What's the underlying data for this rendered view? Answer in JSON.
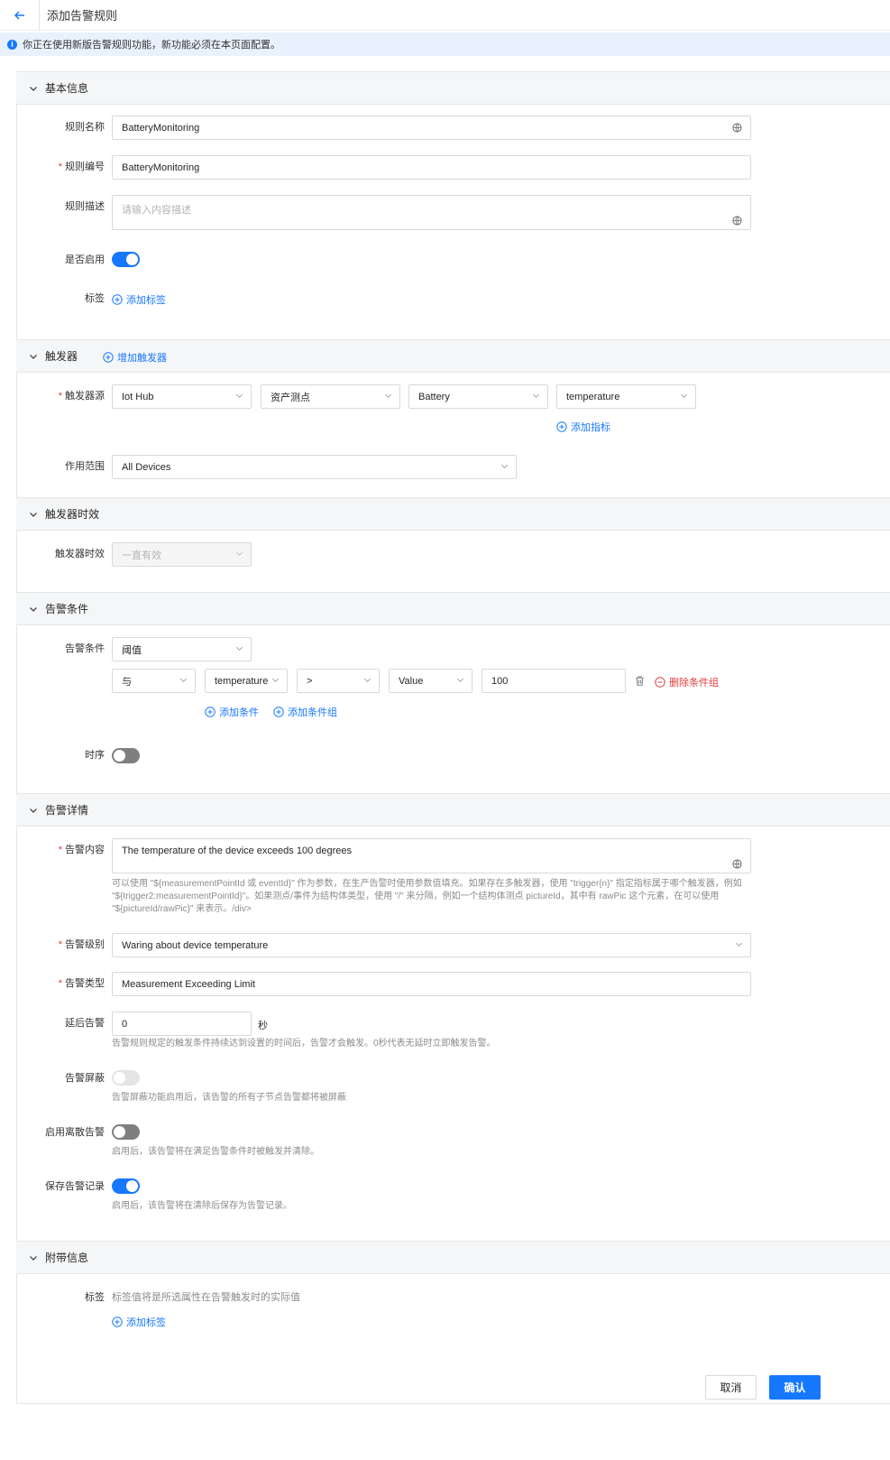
{
  "header": {
    "title": "添加告警规则"
  },
  "banner": {
    "text": "你正在使用新版告警规则功能，新功能必须在本页面配置。"
  },
  "sections": {
    "basic": "基本信息",
    "trigger": "触发器",
    "trigger_time": "触发器时效",
    "condition": "告警条件",
    "detail": "告警详情",
    "extra": "附带信息"
  },
  "basic": {
    "name_label": "规则名称",
    "name_value": "BatteryMonitoring",
    "code_label": "规则编号",
    "code_value": "BatteryMonitoring",
    "desc_label": "规则描述",
    "desc_placeholder": "请输入内容描述",
    "enabled_label": "是否启用",
    "tags_label": "标签",
    "add_tag": "添加标签"
  },
  "trigger": {
    "add_trigger": "增加触发器",
    "source_label": "触发器源",
    "source": "Iot Hub",
    "point_type": "资产测点",
    "asset": "Battery",
    "metric": "temperature",
    "add_metric": "添加指标",
    "scope_label": "作用范围",
    "scope": "All Devices"
  },
  "trigger_time": {
    "label": "触发器时效",
    "value": "一直有效"
  },
  "condition": {
    "label": "告警条件",
    "type": "阈值",
    "logic": "与",
    "field": "temperature",
    "operator": ">",
    "value_type": "Value",
    "threshold": "100",
    "delete_group": "删除条件组",
    "add_condition": "添加条件",
    "add_group": "添加条件组",
    "sequence_label": "时序"
  },
  "detail": {
    "content_label": "告警内容",
    "content_value": "The temperature of the device exceeds 100 degrees",
    "content_help_1": "可以使用 \"${measurementPointId 或 eventId}\" 作为参数，在生产告警时使用参数值填充。如果存在多触发器，使用 \"trigger{n}\" 指定指标属于哪个触发器，例如",
    "content_help_2": "\"${trigger2:measurementPointId}\"。如果测点/事件为结构体类型，使用 \"/\" 来分隔，例如一个结构体测点 pictureId，其中有 rawPic 这个元素，在可以使用",
    "content_help_3": "\"${pictureId/rawPic}\" 来表示。/div>",
    "level_label": "告警级别",
    "level_value": "Waring about device temperature",
    "type_label": "告警类型",
    "type_value": "Measurement Exceeding Limit",
    "delay_label": "延后告警",
    "delay_value": "0",
    "delay_unit": "秒",
    "delay_help": "告警规则规定的触发条件持续达到设置的时间后，告警才会触发。0秒代表无延时立即触发告警。",
    "mask_label": "告警屏蔽",
    "mask_help": "告警屏蔽功能启用后，该告警的所有子节点告警都将被屏蔽",
    "discrete_label": "启用离散告警",
    "discrete_help": "启用后，该告警将在满足告警条件时被触发并清除。",
    "save_label": "保存告警记录",
    "save_help": "启用后，该告警将在清除后保存为告警记录。"
  },
  "extra": {
    "tags_label": "标签",
    "tags_help": "标签值将是所选属性在告警触发时的实际值",
    "add_tag": "添加标签"
  },
  "footer": {
    "cancel": "取消",
    "confirm": "确认"
  },
  "colors": {
    "primary": "#1677ff",
    "danger": "#e03e3e",
    "banner_bg": "#e8f1fd"
  }
}
